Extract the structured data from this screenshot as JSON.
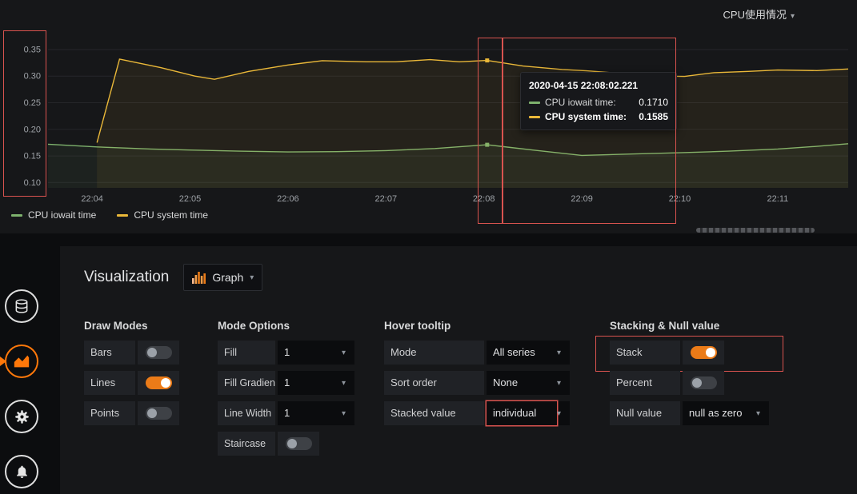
{
  "colors": {
    "accent_orange": "#eb7b18",
    "annotation_red": "#d9534f",
    "series_green": "#7eb26d",
    "series_yellow": "#eab839"
  },
  "panel": {
    "title": "CPU使用情况",
    "legend": [
      {
        "label": "CPU iowait time",
        "color": "#7eb26d"
      },
      {
        "label": "CPU system time",
        "color": "#eab839"
      }
    ],
    "tooltip": {
      "timestamp": "2020-04-15 22:08:02.221",
      "rows": [
        {
          "label": "CPU iowait time:",
          "value": "0.1710",
          "color": "#7eb26d"
        },
        {
          "label": "CPU system time:",
          "value": "0.1585",
          "color": "#eab839"
        }
      ]
    }
  },
  "chart_data": {
    "type": "line",
    "title": "CPU使用情况",
    "stacked": true,
    "legend_position": "bottom-left",
    "x_axis": {
      "tick_labels": [
        "22:04",
        "22:05",
        "22:06",
        "22:07",
        "22:08",
        "22:09",
        "22:10",
        "22:11"
      ],
      "tick_minutes": [
        4,
        5,
        6,
        7,
        8,
        9,
        10,
        11
      ],
      "range_minutes": [
        3.55,
        11.72
      ]
    },
    "y_axis": {
      "tick_values": [
        0.35,
        0.3,
        0.25,
        0.2,
        0.15,
        0.1
      ],
      "range": [
        0.09,
        0.38
      ]
    },
    "hover": {
      "minute": 8.034,
      "time": "2020-04-15 22:08:02.221"
    },
    "series": [
      {
        "name": "CPU iowait time",
        "color": "#7eb26d",
        "hover_value": 0.171,
        "hover_display": 0.171,
        "points": [
          [
            3.55,
            0.172
          ],
          [
            4.05,
            0.167
          ],
          [
            4.6,
            0.163
          ],
          [
            5.0,
            0.161
          ],
          [
            5.5,
            0.159
          ],
          [
            6.0,
            0.1575
          ],
          [
            6.5,
            0.158
          ],
          [
            7.0,
            0.16
          ],
          [
            7.5,
            0.164
          ],
          [
            8.034,
            0.171
          ],
          [
            8.5,
            0.161
          ],
          [
            9.0,
            0.151
          ],
          [
            9.5,
            0.1535
          ],
          [
            10.0,
            0.156
          ],
          [
            10.5,
            0.159
          ],
          [
            11.0,
            0.163
          ],
          [
            11.4,
            0.168
          ],
          [
            11.72,
            0.173
          ]
        ]
      },
      {
        "name": "CPU system time",
        "color": "#eab839",
        "hover_value": 0.1585,
        "hover_display": 0.3295,
        "points": [
          [
            4.05,
            0.175
          ],
          [
            4.28,
            0.332
          ],
          [
            4.7,
            0.316
          ],
          [
            5.05,
            0.3
          ],
          [
            5.25,
            0.294
          ],
          [
            5.6,
            0.309
          ],
          [
            6.0,
            0.321
          ],
          [
            6.35,
            0.329
          ],
          [
            6.8,
            0.327
          ],
          [
            7.1,
            0.327
          ],
          [
            7.45,
            0.331
          ],
          [
            7.75,
            0.327
          ],
          [
            8.034,
            0.3295
          ],
          [
            8.4,
            0.319
          ],
          [
            8.8,
            0.3125
          ],
          [
            9.05,
            0.31
          ],
          [
            9.45,
            0.3045
          ],
          [
            9.8,
            0.3
          ],
          [
            10.05,
            0.2995
          ],
          [
            10.35,
            0.3065
          ],
          [
            10.7,
            0.309
          ],
          [
            11.0,
            0.3115
          ],
          [
            11.4,
            0.3105
          ],
          [
            11.72,
            0.3135
          ]
        ]
      }
    ]
  },
  "editor": {
    "visualization_label": "Visualization",
    "viz_picker": {
      "value": "Graph",
      "icon": "bar-chart-icon"
    },
    "tabs": [
      {
        "icon": "queries-icon",
        "active": false
      },
      {
        "icon": "visualization-icon",
        "active": true
      },
      {
        "icon": "general-settings-icon",
        "active": false
      },
      {
        "icon": "alert-icon",
        "active": false
      }
    ],
    "sections": {
      "draw_modes": {
        "title": "Draw Modes",
        "toggles": [
          {
            "label": "Bars",
            "on": false
          },
          {
            "label": "Lines",
            "on": true
          },
          {
            "label": "Points",
            "on": false
          }
        ]
      },
      "mode_options": {
        "title": "Mode Options",
        "rows": [
          {
            "label": "Fill",
            "type": "select",
            "value": "1"
          },
          {
            "label": "Fill Gradient",
            "type": "select",
            "value": "1"
          },
          {
            "label": "Line Width",
            "type": "select",
            "value": "1"
          },
          {
            "label": "Staircase",
            "type": "toggle",
            "on": false
          }
        ]
      },
      "hover_tooltip": {
        "title": "Hover tooltip",
        "rows": [
          {
            "label": "Mode",
            "value": "All series"
          },
          {
            "label": "Sort order",
            "value": "None"
          },
          {
            "label": "Stacked value",
            "value": "individual",
            "annotated": true
          }
        ]
      },
      "stacking": {
        "title": "Stacking & Null value",
        "rows": [
          {
            "label": "Stack",
            "type": "toggle",
            "on": true,
            "annotated": true
          },
          {
            "label": "Percent",
            "type": "toggle",
            "on": false
          },
          {
            "label": "Null value",
            "type": "select",
            "value": "null as zero"
          }
        ]
      }
    }
  }
}
